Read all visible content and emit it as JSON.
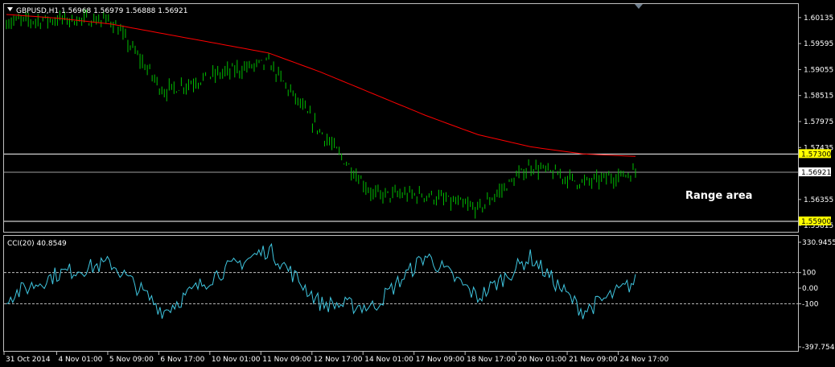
{
  "header": {
    "symbol_line": "GBPUSD,H1  1.56968 1.56979 1.56888 1.56921",
    "menu_arrow": "triangle-down-icon"
  },
  "annotation": {
    "range_text": "Range area"
  },
  "price_axis": {
    "ticks": [
      "1.60135",
      "1.59595",
      "1.59055",
      "1.58515",
      "1.57975",
      "1.57435",
      "1.56355",
      "1.55815"
    ],
    "current_price_label": "1.56921",
    "resistance_label": "1.57300",
    "support_label": "1.55900"
  },
  "indicator": {
    "title": "CCI(20) 40.8549",
    "axis_ticks": [
      "330.9455",
      "100",
      "0.00",
      "-100",
      "-397.754"
    ]
  },
  "time_axis": {
    "labels": [
      "31 Oct 2014",
      "4 Nov 01:00",
      "5 Nov 09:00",
      "6 Nov 17:00",
      "10 Nov 01:00",
      "11 Nov 09:00",
      "12 Nov 17:00",
      "14 Nov 01:00",
      "17 Nov 09:00",
      "18 Nov 17:00",
      "20 Nov 01:00",
      "21 Nov 09:00",
      "24 Nov 17:00"
    ]
  },
  "colors": {
    "background": "#000000",
    "bars": "#00c000",
    "moving_average": "#ff0000",
    "cci_line": "#3fc6e0",
    "grid": "#c0c0c0",
    "highlight_label": "#ffff00"
  },
  "chart_data": [
    {
      "type": "line",
      "title": "GBPUSD,H1",
      "xlabel": "",
      "ylabel": "",
      "x": [
        "31 Oct 2014",
        "4 Nov 01:00",
        "5 Nov 09:00",
        "6 Nov 17:00",
        "10 Nov 01:00",
        "11 Nov 09:00",
        "12 Nov 17:00",
        "14 Nov 01:00",
        "17 Nov 09:00",
        "18 Nov 17:00",
        "20 Nov 01:00",
        "21 Nov 09:00",
        "24 Nov 17:00"
      ],
      "series": [
        {
          "values": [
            1.6005,
            1.601,
            1.6008,
            1.586,
            1.5895,
            1.592,
            1.5775,
            1.5645,
            1.5645,
            1.5615,
            1.5705,
            1.567,
            1.5692
          ]
        },
        {
          "values": [
            1.602,
            1.6012,
            1.6,
            1.598,
            1.596,
            1.594,
            1.59,
            1.5855,
            1.581,
            1.577,
            1.5745,
            1.573,
            1.5725
          ]
        }
      ],
      "horizontal_lines": [
        1.573,
        1.5692,
        1.559
      ],
      "ylim": [
        1.557,
        1.604
      ],
      "grid": false
    },
    {
      "type": "line",
      "title": "CCI(20) 40.8549",
      "x": [
        "31 Oct 2014",
        "4 Nov 01:00",
        "5 Nov 09:00",
        "6 Nov 17:00",
        "10 Nov 01:00",
        "11 Nov 09:00",
        "12 Nov 17:00",
        "14 Nov 01:00",
        "17 Nov 09:00",
        "18 Nov 17:00",
        "20 Nov 01:00",
        "21 Nov 09:00",
        "24 Nov 17:00"
      ],
      "series": [
        {
          "values": [
            -60,
            95,
            160,
            -150,
            90,
            250,
            -100,
            -120,
            210,
            -60,
            200,
            -150,
            40.85
          ]
        }
      ],
      "horizontal_lines": [
        100,
        0,
        -100
      ],
      "ylim": [
        -397.754,
        330.9455
      ],
      "grid": false
    }
  ]
}
